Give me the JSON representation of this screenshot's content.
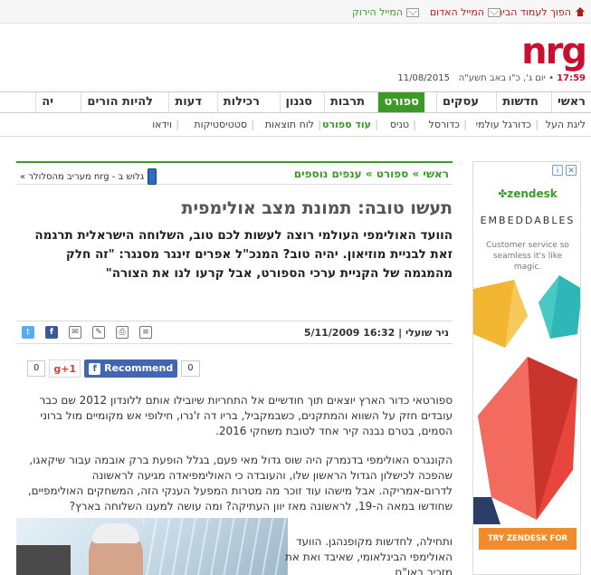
{
  "utility": {
    "home": "הפוך לעמוד הבית",
    "mail_red": "המייל האדום",
    "mail_green": "המייל הירוק"
  },
  "header": {
    "logo": "nrg",
    "time": "17:59",
    "hebdate": "יום ג', כ\"ו באב תשע\"ה",
    "gdate": "11/08/2015"
  },
  "mainnav": [
    "ראשי",
    "חדשות",
    "עסקים",
    "ספורט",
    "תרבות",
    "סגנון",
    "רכילות",
    "דעות",
    "להיות הורים",
    "יה"
  ],
  "mainnav_active": "ספורט",
  "subnav": [
    "ליגת העל",
    "כדורגל עולמי",
    "כדורסל",
    "טניס",
    "עוד ספורט",
    "לוח תוצאות",
    "סטטיסטיקות",
    "וידאו"
  ],
  "subnav_active": "עוד ספורט",
  "ad": {
    "brand": "zendesk",
    "tagline": "EMBEDDABLES",
    "copy": "Customer service so seamless it's like magic.",
    "cta": "TRY ZENDESK FOR FREE",
    "colors": {
      "teal": "#2fb6b6",
      "red": "#e8453c",
      "yellow": "#f2b632",
      "navy": "#2c3e66"
    }
  },
  "article": {
    "breadcrumb": "ראשי » ספורט » ענפים נוספים",
    "mobile_promo": "גלוש ב - nrg מעריב מהסלולר »",
    "title": "תעשו טובה: תמונת מצב אולימפית",
    "lead": "הוועד האולימפי העולמי רוצה לעשות לכם טוב, השלוחה הישראלית תרגמה זאת לבניית מוזיאון. יהיה טוב? המנכ\"ל אפרים זינגר מסנגר: \"זה חלק מהמגמה של הקניית ערכי הספורט, אבל קרעו לנו את הצורה\"",
    "author": "ניר שועלי",
    "date": "16:32 5/11/2009",
    "social": {
      "like_count": "0",
      "plus_count": "0",
      "recommend": "Recommend",
      "gplus": "g+1",
      "fb": "f"
    },
    "p1": "ספורטאי כדור הארץ יוצאים תוך חודשיים אל התחריות שיובילו אותם ללונדון 2012 שם כבר עובדים חזק על השווא והמתקנים, כשבמקביל, בריו דה ז'נרו, חילופי אש מקומיים מול ברוני הסמים, בטרם נבנה קיר אחד לטובת משחקי 2016.",
    "p2": "הקונגרס האולימפי בדנמרק היה שוס גדול מאי פעם, בגלל הופעת ברק אובמה עבור שיקאגו, שהפכה לכישלון הגדול הראשון שלו, והעובדה כי האולימפיאדה מגיעה לראשונה לדרום-אמריקה. אבל מישהו עוד זוכר מה מטרות המפעל הענקי הזה, המשחקים האולימפיים, שחודשו במאה ה-19, לראשונה מאז יוון העתיקה? ומה עושה למענו השלוחה בארץ?",
    "p3": "ותחילה, לחדשות מקופנהגן. הוועד האולימפי הבינלאומי, שאיבד ואת את מזכיר באו\"ם"
  },
  "icons": {
    "envelope": "envelope-icon",
    "home": "home-icon",
    "phone": "mobile-phone-icon",
    "comment": "comment-icon",
    "print": "print-icon",
    "edit": "pencil-icon",
    "mail": "mail-icon",
    "facebook": "facebook-icon",
    "twitter": "twitter-icon"
  }
}
